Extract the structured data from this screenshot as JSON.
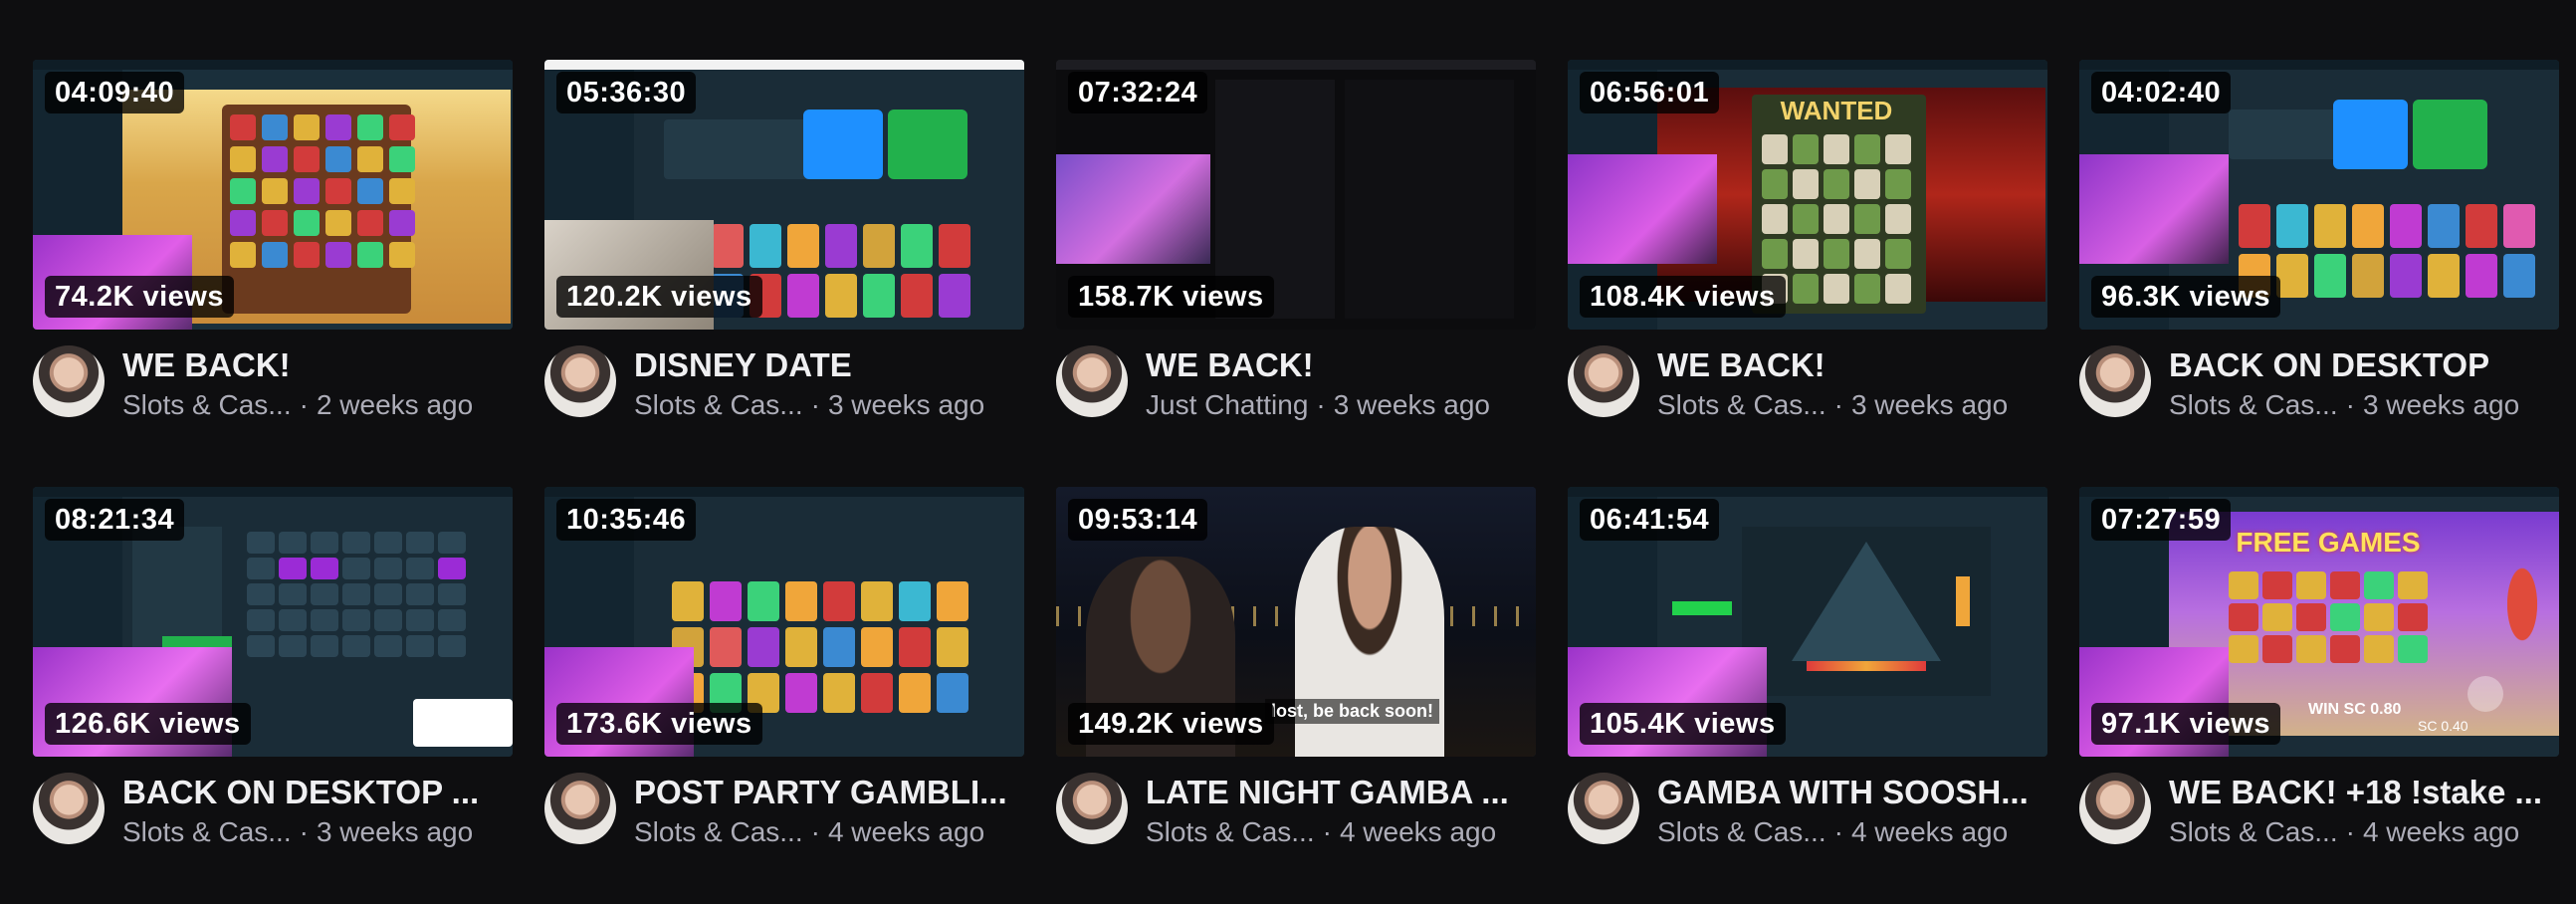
{
  "videos": [
    {
      "duration": "04:09:40",
      "views": "74.2K views",
      "title": "WE BACK!",
      "category": "Slots & Cas...",
      "age": "2 weeks ago"
    },
    {
      "duration": "05:36:30",
      "views": "120.2K views",
      "title": "DISNEY DATE",
      "category": "Slots & Cas...",
      "age": "3 weeks ago"
    },
    {
      "duration": "07:32:24",
      "views": "158.7K views",
      "title": "WE BACK!",
      "category": "Just Chatting",
      "age": "3 weeks ago"
    },
    {
      "duration": "06:56:01",
      "views": "108.4K views",
      "title": "WE BACK!",
      "category": "Slots & Cas...",
      "age": "3 weeks ago"
    },
    {
      "duration": "04:02:40",
      "views": "96.3K views",
      "title": "BACK ON DESKTOP",
      "category": "Slots & Cas...",
      "age": "3 weeks ago"
    },
    {
      "duration": "08:21:34",
      "views": "126.6K views",
      "title": "BACK ON DESKTOP ...",
      "category": "Slots & Cas...",
      "age": "3 weeks ago"
    },
    {
      "duration": "10:35:46",
      "views": "173.6K views",
      "title": "POST PARTY GAMBLI...",
      "category": "Slots & Cas...",
      "age": "4 weeks ago"
    },
    {
      "duration": "09:53:14",
      "views": "149.2K views",
      "title": "LATE NIGHT GAMBA ...",
      "category": "Slots & Cas...",
      "age": "4 weeks ago"
    },
    {
      "duration": "06:41:54",
      "views": "105.4K views",
      "title": "GAMBA WITH SOOSH...",
      "category": "Slots & Cas...",
      "age": "4 weeks ago"
    },
    {
      "duration": "07:27:59",
      "views": "97.1K views",
      "title": "WE BACK! +18 !stake ...",
      "category": "Slots & Cas...",
      "age": "4 weeks ago"
    }
  ],
  "separator": "·",
  "thumb_text": {
    "v4_logo": "WANTED",
    "v8_caption": "lost, be back soon!",
    "v10_logo": "FREE GAMES",
    "v10_win": "WIN SC 0.80",
    "v10_sc": "SC 0.40"
  }
}
